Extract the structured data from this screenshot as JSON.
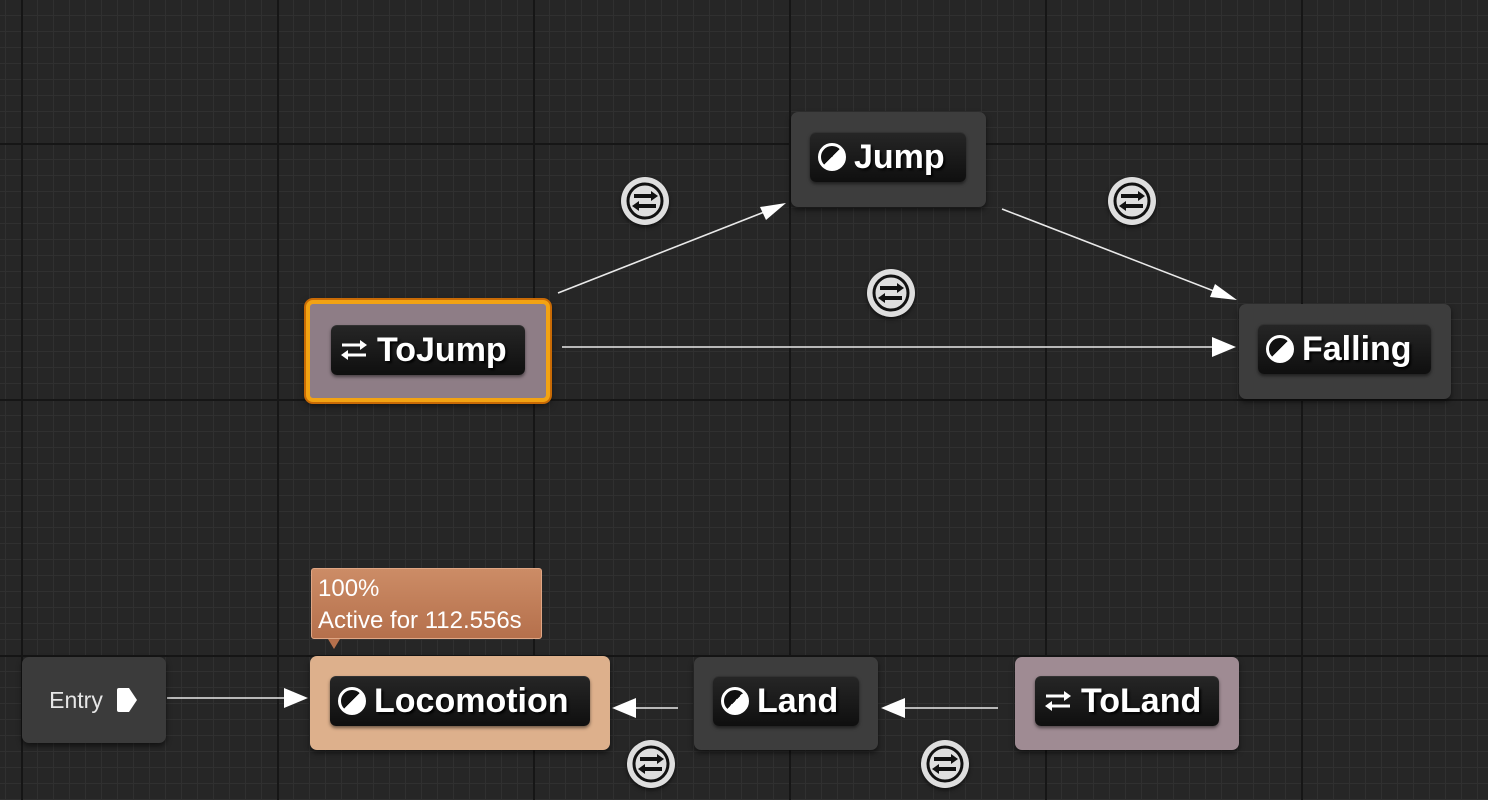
{
  "graph": {
    "entry": {
      "label": "Entry"
    },
    "states": {
      "jump": {
        "label": "Jump"
      },
      "falling": {
        "label": "Falling"
      },
      "locomotion": {
        "label": "Locomotion"
      },
      "land": {
        "label": "Land"
      }
    },
    "conduits": {
      "to_jump": {
        "label": "ToJump"
      },
      "to_land": {
        "label": "ToLand"
      }
    },
    "debug_tooltip": {
      "weight": "100%",
      "status": "Active for 112.556s"
    }
  },
  "colors": {
    "background": "#262626",
    "state_node": "#3d3d3d",
    "active_state": "#ddb08c",
    "conduit_node": "#9f8b93",
    "selection": "#f2a313",
    "tooltip": "#c07c58"
  },
  "icons": {
    "state": "state-half-circle-icon",
    "conduit": "conduit-arrows-icon",
    "transition_rule": "transition-rule-icon",
    "entry_pin": "entry-pin-icon"
  }
}
